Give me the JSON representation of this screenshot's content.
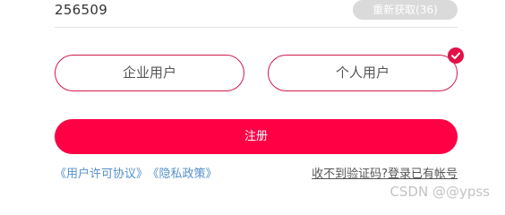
{
  "verification": {
    "code_value": "256509",
    "resend_label": "重新获取(36)"
  },
  "user_type": {
    "enterprise_label": "企业用户",
    "personal_label": "个人用户",
    "selected": "personal"
  },
  "register_label": "注册",
  "links": {
    "license_agreement": "《用户许可协议》",
    "privacy_policy": "《隐私政策》",
    "no_code_received": "收不到验证码?",
    "login_existing": "登录已有帐号"
  },
  "watermark": "CSDN @@ypss",
  "colors": {
    "accent": "#ff0045",
    "option_border": "#d1184a",
    "link_blue": "#5590c9",
    "resend_disabled": "#dadada"
  }
}
